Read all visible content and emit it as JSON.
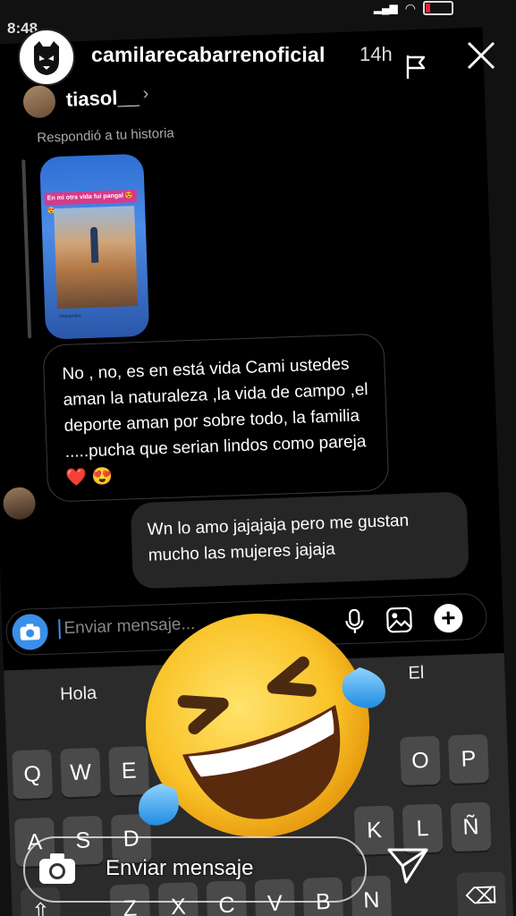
{
  "status": {
    "time": "8:48"
  },
  "story": {
    "owner": "camilarecabarrenoficial",
    "age": "14h"
  },
  "chat": {
    "username": "tiasol__",
    "chevron": "›",
    "replied_label": "Respondió a tu historia",
    "story_caption": "En mi otra vida fui pangal 😍😍",
    "story_footer": "Recuerdos",
    "incoming": "No , no, es en está vida Cami ustedes aman la naturaleza ,la vida de campo ,el deporte aman por sobre todo, la familia .....pucha que serian lindos como pareja❤️ 😍",
    "outgoing": "Wn lo amo jajajaja pero me gustan mucho las mujeres jajaja",
    "compose_placeholder": "Enviar mensaje..."
  },
  "keyboard": {
    "suggestions": [
      "Hola",
      "",
      "El"
    ],
    "row1": [
      "Q",
      "W",
      "E",
      "",
      "",
      "",
      "",
      "",
      "O",
      "P"
    ],
    "row2": [
      "A",
      "S",
      "D",
      "",
      "",
      "",
      "K",
      "L",
      "Ñ"
    ],
    "row3": [
      "Z",
      "X",
      "C",
      "V",
      "B",
      "N",
      "M"
    ]
  },
  "reply_bar": {
    "placeholder": "Enviar mensaje"
  },
  "icons": {
    "flag": "flag-icon",
    "close": "close-icon",
    "camera": "camera-icon",
    "mic": "microphone-icon",
    "gallery": "gallery-icon",
    "plus": "plus-icon",
    "send": "send-icon",
    "emoji": "rolling-on-the-floor-laughing-emoji",
    "backspace": "backspace-icon",
    "shift": "shift-icon"
  },
  "colors": {
    "accent": "#3a8fe8",
    "battery": "#e23a3a",
    "bubble_out": "#262626",
    "heart": "#e8262b"
  }
}
